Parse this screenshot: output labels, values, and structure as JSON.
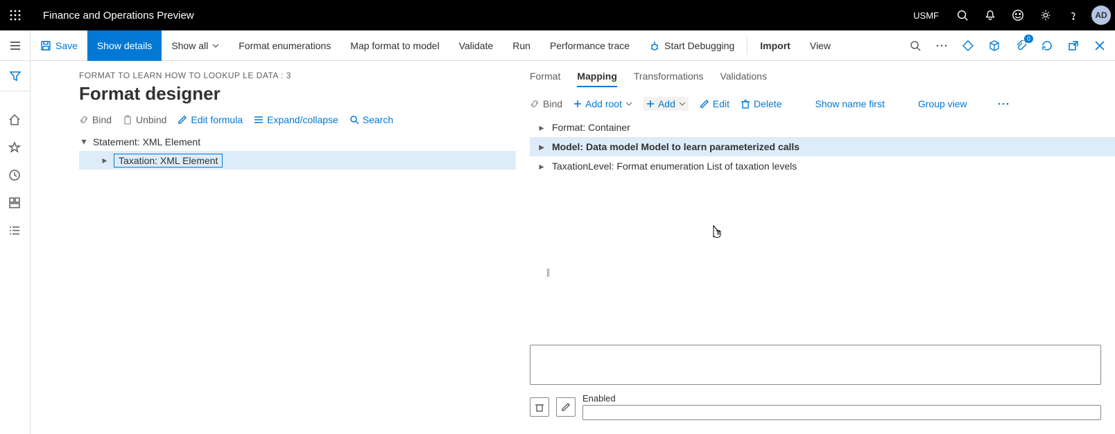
{
  "topbar": {
    "app_title": "Finance and Operations Preview",
    "company": "USMF",
    "avatar_initials": "AD"
  },
  "commandbar": {
    "save": "Save",
    "show_details": "Show details",
    "show_all": "Show all",
    "format_enum": "Format enumerations",
    "map_format": "Map format to model",
    "validate": "Validate",
    "run": "Run",
    "perf_trace": "Performance trace",
    "start_debug": "Start Debugging",
    "import": "Import",
    "view": "View",
    "debug_count": "0"
  },
  "page": {
    "breadcrumb": "FORMAT TO LEARN HOW TO LOOKUP LE DATA : 3",
    "title": "Format designer"
  },
  "left_toolbar": {
    "bind": "Bind",
    "unbind": "Unbind",
    "edit_formula": "Edit formula",
    "expand": "Expand/collapse",
    "search": "Search"
  },
  "left_tree": {
    "root": "Statement: XML Element",
    "child1": "Taxation: XML Element"
  },
  "tabs": {
    "format": "Format",
    "mapping": "Mapping",
    "transformations": "Transformations",
    "validations": "Validations"
  },
  "right_toolbar": {
    "bind": "Bind",
    "add_root": "Add root",
    "add": "Add",
    "edit": "Edit",
    "delete": "Delete",
    "show_name_first": "Show name first",
    "group_view": "Group view"
  },
  "right_tree": {
    "row1": "Format: Container",
    "row2": "Model: Data model Model to learn parameterized calls",
    "row3": "TaxationLevel: Format enumeration List of taxation levels"
  },
  "bottom": {
    "enabled_label": "Enabled"
  }
}
